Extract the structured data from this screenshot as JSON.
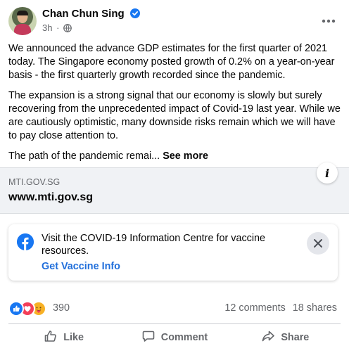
{
  "post": {
    "author": "Chan Chun Sing",
    "time": "3h",
    "dot": "·",
    "paragraphs": [
      "We announced the advance GDP estimates for the first quarter of 2021 today. The Singapore economy posted growth of 0.2% on a year-on-year basis - the first quarterly growth recorded since the pandemic.",
      "The expansion is a strong signal that our economy is slowly but surely recovering from the unprecedented impact of Covid-19 last year. While we are cautiously optimistic, many downside risks remain which we will have to pay close attention to."
    ],
    "truncated_text": "The path of the pandemic remai... ",
    "see_more": "See more"
  },
  "link": {
    "domain": "MTI.GOV.SG",
    "title": "www.mti.gov.sg"
  },
  "covid": {
    "text": "Visit the COVID-19 Information Centre for vaccine resources.",
    "link": "Get Vaccine Info"
  },
  "stats": {
    "reactions": "390",
    "comments": "12 comments",
    "shares": "18 shares"
  },
  "actions": {
    "like": "Like",
    "comment": "Comment",
    "share": "Share"
  },
  "colors": {
    "accent": "#1877f2",
    "link_blue": "#216fdb",
    "secondary_text": "#65676b"
  },
  "icons": [
    "verified-badge-icon",
    "globe-icon",
    "more-options-icon",
    "info-icon",
    "facebook-logo-icon",
    "close-icon",
    "like-reaction-icon",
    "love-reaction-icon",
    "care-reaction-icon",
    "like-icon",
    "comment-icon",
    "share-icon"
  ]
}
